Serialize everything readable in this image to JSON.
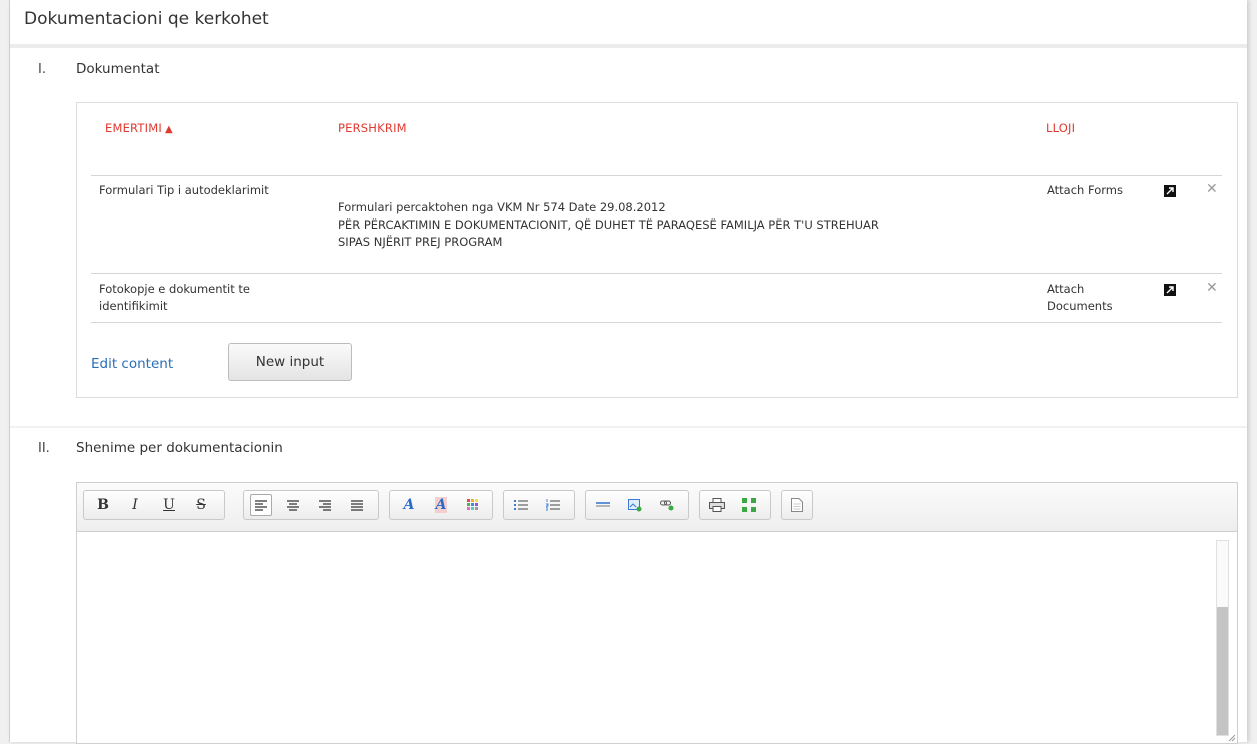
{
  "page": {
    "title": "Dokumentacioni qe kerkohet"
  },
  "section1": {
    "number": "I.",
    "title": "Dokumentat"
  },
  "table": {
    "headers": {
      "name": "EMERTIMI",
      "sort_arrow": "▲",
      "description": "PERSHKRIM",
      "type": "LLOJI"
    },
    "rows": [
      {
        "name": "Formulari Tip i autodeklarimit",
        "description_line1": "Formulari percaktohen nga VKM Nr 574 Date 29.08.2012",
        "description_line2": "PËR PËRCAKTIMIN E DOKUMENTACIONIT, QË DUHET TË PARAQESË FAMILJA PËR T'U STREHUAR",
        "description_line3": "SIPAS NJËRIT PREJ PROGRAM",
        "type": "Attach Forms"
      },
      {
        "name_line1": "Fotokopje e dokumentit te",
        "name_line2": "identifikimit",
        "description": "",
        "type_line1": "Attach",
        "type_line2": "Documents"
      }
    ],
    "edit_label": "Edit content",
    "new_input_label": "New input"
  },
  "section2": {
    "number": "II.",
    "title": "Shenime per dokumentacionin"
  },
  "editor": {
    "toolbar_icons": [
      "bold-icon",
      "italic-icon",
      "underline-icon",
      "strikethrough-icon",
      "align-left-icon",
      "align-center-icon",
      "align-right-icon",
      "align-justify-icon",
      "font-color-icon",
      "font-background-icon",
      "color-palette-icon",
      "bullet-list-icon",
      "numbered-list-icon",
      "horizontal-rule-icon",
      "insert-image-icon",
      "insert-link-icon",
      "print-icon",
      "fullscreen-icon",
      "source-document-icon"
    ],
    "content": ""
  },
  "colors": {
    "header_red": "#e03a30",
    "link_blue": "#2a6db8"
  }
}
